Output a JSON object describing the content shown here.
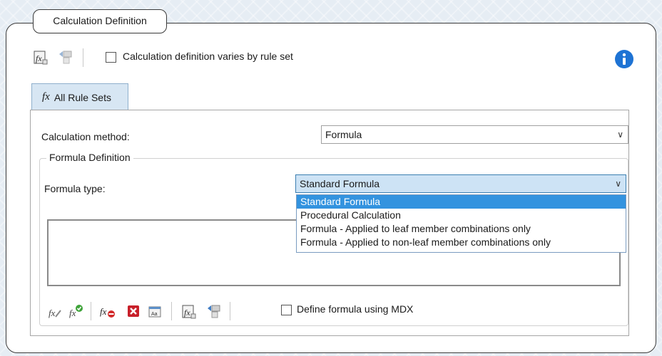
{
  "panel": {
    "title": "Calculation Definition"
  },
  "top_toolbar": {
    "varies_checkbox_label": "Calculation definition varies by rule set",
    "varies_checked": false
  },
  "tabs": [
    {
      "label": "All Rule Sets",
      "icon": "fx-icon"
    }
  ],
  "calc_method": {
    "label": "Calculation method:",
    "value": "Formula"
  },
  "formula_def": {
    "legend": "Formula Definition",
    "type_label": "Formula type:",
    "type_value": "Standard Formula",
    "options": [
      "Standard Formula",
      "Procedural Calculation",
      "Formula - Applied to leaf member combinations only",
      "Formula - Applied to non-leaf member combinations only"
    ],
    "selected_index": 0
  },
  "bottom_toolbar": {
    "mdx_checkbox_label": "Define formula using MDX",
    "mdx_checked": false
  },
  "colors": {
    "accent_blue": "#1e73d4",
    "selection": "#3393df",
    "tab_bg": "#d7e6f3",
    "delete_red": "#c8202a"
  }
}
